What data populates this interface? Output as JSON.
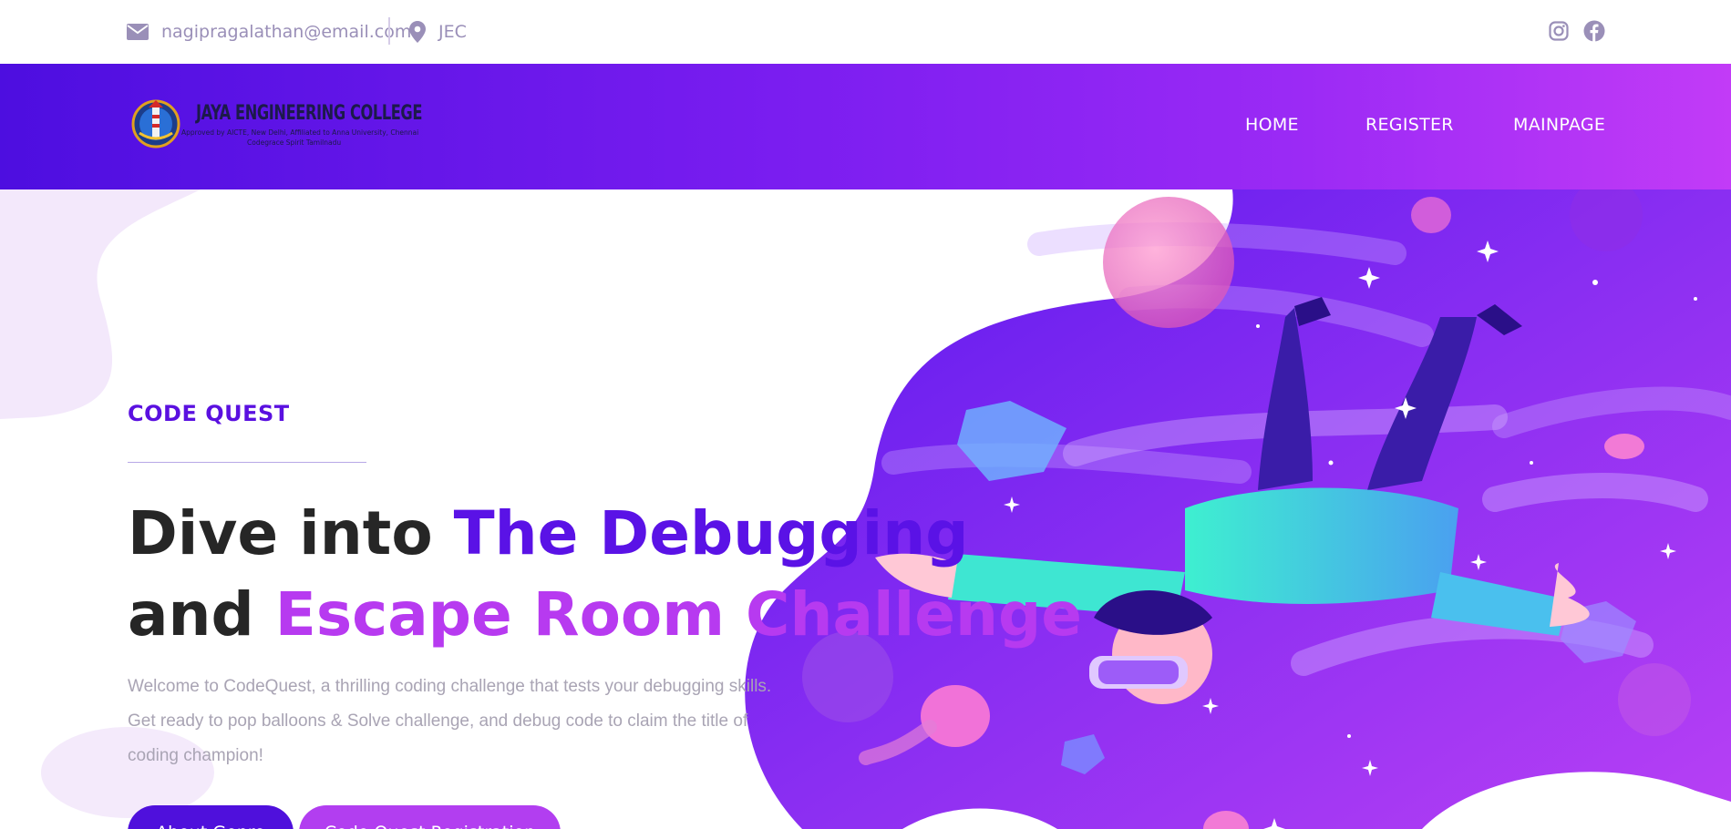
{
  "topbar": {
    "email": "nagipragalathan@email.com",
    "location": "JEC",
    "icons": [
      "envelope-icon",
      "map-pin-icon",
      "instagram-icon",
      "facebook-icon"
    ]
  },
  "brand": {
    "name": "JAYA ENGINEERING COLLEGE",
    "subtitle_line1": "Approved by AICTE, New Delhi, Affiliated to Anna University, Chennai",
    "subtitle_line2": "Codegrace Spirit Tamilnadu"
  },
  "nav": {
    "home": "HOME",
    "register": "REGISTER",
    "mainpage": "MAINPAGE"
  },
  "hero": {
    "kicker": "CODE QUEST",
    "headline_part1": "Dive into ",
    "headline_part2": "The Debugging",
    "headline_part3": "and ",
    "headline_part4": "Escape Room Challenge",
    "description": "Welcome to CodeQuest, a thrilling coding challenge that tests your debugging skills. Get ready to pop balloons & Solve challenge, and debug code to claim the title of coding champion!",
    "button_about": "About Genre",
    "button_register": "Code Quest Registration"
  },
  "colors": {
    "primary": "#5a12e6",
    "accent": "#b73af0",
    "nav_gradient_start": "#4d0ee0",
    "nav_gradient_end": "#c23bf7",
    "muted_text": "#a9a4b4"
  }
}
